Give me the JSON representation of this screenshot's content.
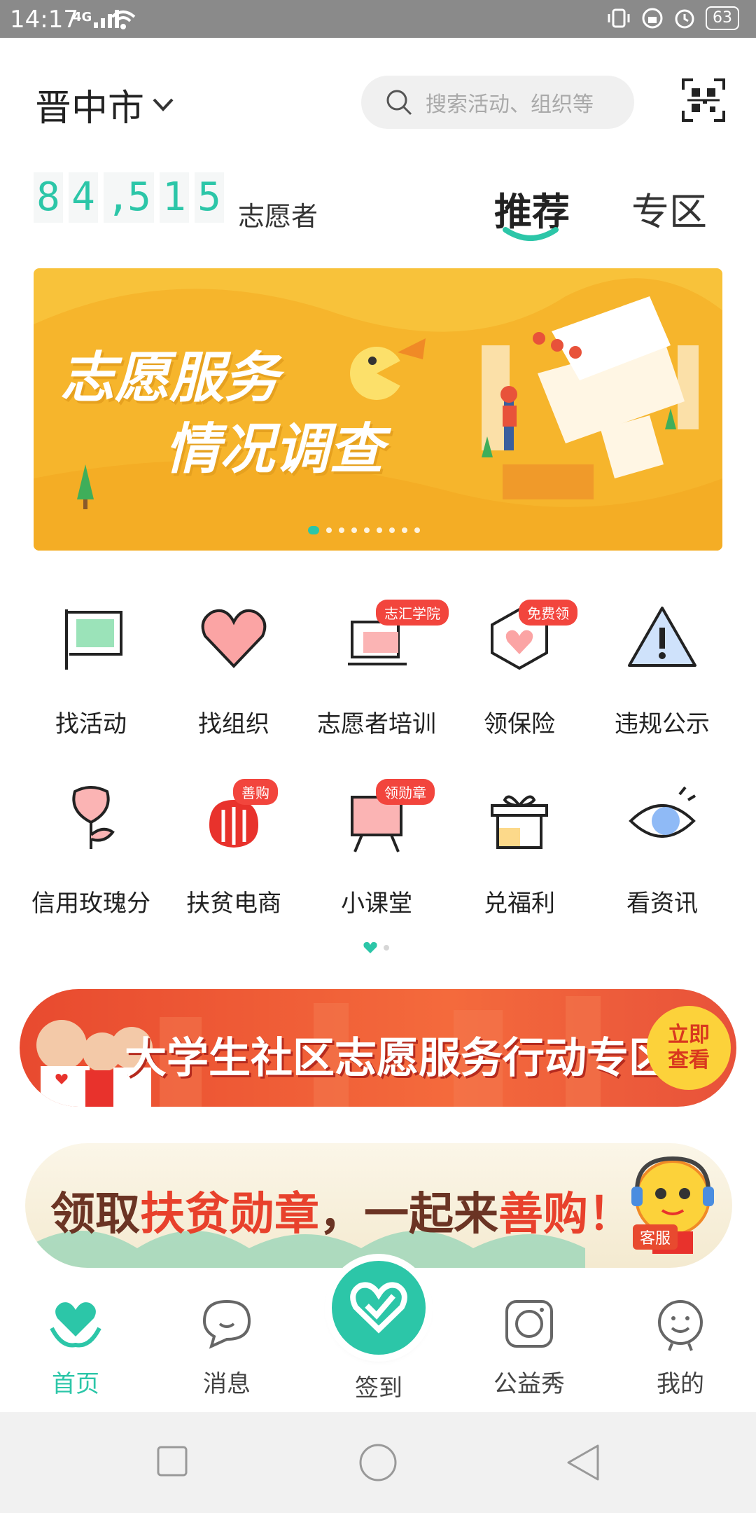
{
  "status_bar": {
    "time": "14:17",
    "network": "4G",
    "battery": "63"
  },
  "header": {
    "city": "晋中市",
    "search_placeholder": "搜索活动、组织等"
  },
  "counter": {
    "digits": [
      "8",
      "4",
      ",",
      "5",
      "1",
      "5"
    ],
    "label": "志愿者"
  },
  "tabs": [
    {
      "label": "推荐",
      "active": true
    },
    {
      "label": "专区",
      "active": false
    }
  ],
  "banner": {
    "line1": "志愿服务",
    "line2": "情况调查",
    "slide_count": 9,
    "active_slide": 0
  },
  "grid": [
    {
      "label": "找活动",
      "icon": "flag-icon"
    },
    {
      "label": "找组织",
      "icon": "heart-icon"
    },
    {
      "label": "志愿者培训",
      "icon": "computer-icon",
      "badge": "志汇学院"
    },
    {
      "label": "领保险",
      "icon": "shield-heart-icon",
      "badge": "免费领"
    },
    {
      "label": "违规公示",
      "icon": "warning-icon"
    },
    {
      "label": "信用玫瑰分",
      "icon": "rose-icon"
    },
    {
      "label": "扶贫电商",
      "icon": "shop-logo-icon",
      "badge": "善购"
    },
    {
      "label": "小课堂",
      "icon": "easel-icon",
      "badge": "领勋章"
    },
    {
      "label": "兑福利",
      "icon": "gift-icon"
    },
    {
      "label": "看资讯",
      "icon": "eye-icon"
    }
  ],
  "promo1": {
    "text": "大学生社区志愿服务行动专区",
    "cta_line1": "立即",
    "cta_line2": "查看"
  },
  "promo2": {
    "part1": "领取",
    "part2": "扶贫勋章",
    "part3": "，一起来",
    "part4": "善购",
    "part5": "！",
    "service_label": "客服"
  },
  "bottom_nav": [
    {
      "label": "首页",
      "icon": "home-heart-icon",
      "active": true
    },
    {
      "label": "消息",
      "icon": "chat-icon",
      "active": false
    },
    {
      "label": "签到",
      "icon": "checkin-heart-icon",
      "active": false
    },
    {
      "label": "公益秀",
      "icon": "camera-icon",
      "active": false
    },
    {
      "label": "我的",
      "icon": "profile-face-icon",
      "active": false
    }
  ],
  "colors": {
    "accent": "#2cc6a8",
    "badge": "#f2453d",
    "banner_bg": "#f8c23a"
  }
}
